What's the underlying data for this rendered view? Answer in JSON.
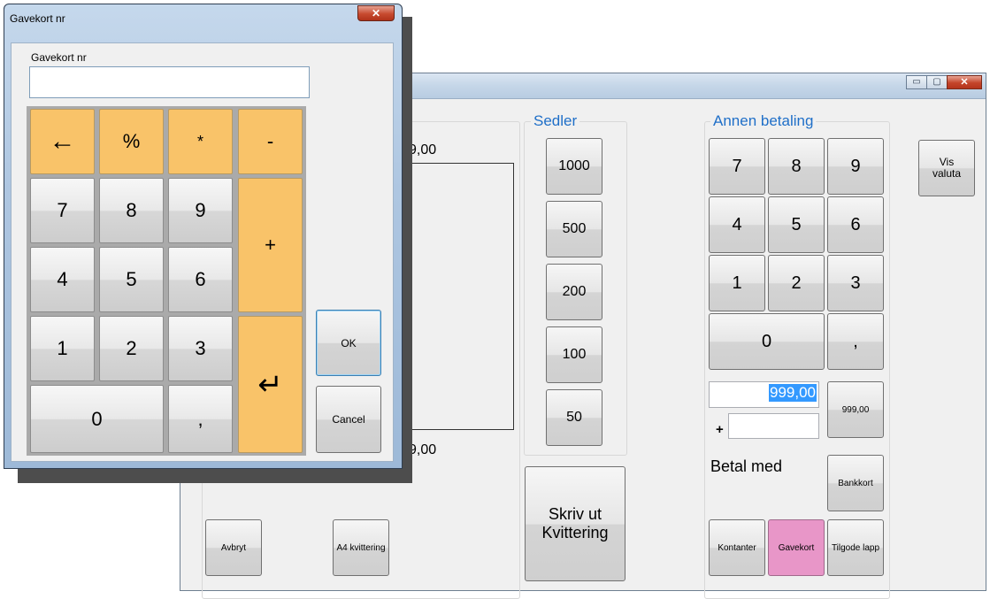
{
  "background_window": {
    "amount_top": "9,00",
    "amount_bottom": "9,00",
    "sedler": {
      "title": "Sedler",
      "notes": [
        "1000",
        "500",
        "200",
        "100",
        "50"
      ]
    },
    "skriv_ut": "Skriv ut Kvittering",
    "annen_betaling": {
      "title": "Annen betaling",
      "keys": [
        "7",
        "8",
        "9",
        "4",
        "5",
        "6",
        "1",
        "2",
        "3",
        "0",
        ","
      ],
      "amount_value": "999,00",
      "amount_button": "999,00",
      "plus_label": "+",
      "plus_value": ""
    },
    "vis_valuta": "Vis valuta",
    "betal_med": "Betal med",
    "bankkort": "Bankkort",
    "kontanter": "Kontanter",
    "gavekort": "Gavekort",
    "tilgode_lapp": "Tilgode lapp",
    "avbryt": "Avbryt",
    "a4_kvittering": "A4 kvittering",
    "window_buttons": {
      "minimize": "▭",
      "maximize": "▢",
      "close": "✕"
    }
  },
  "dialog": {
    "title": "Gavekort nr",
    "close_glyph": "✕",
    "field_label": "Gavekort nr",
    "field_value": "",
    "keys": {
      "backspace": "←",
      "percent": "%",
      "multiply": "*",
      "minus": "-",
      "k7": "7",
      "k8": "8",
      "k9": "9",
      "plus": "+",
      "k4": "4",
      "k5": "5",
      "k6": "6",
      "k1": "1",
      "k2": "2",
      "k3": "3",
      "enter": "↵",
      "k0": "0",
      "comma": ","
    },
    "ok": "OK",
    "cancel": "Cancel"
  },
  "colors": {
    "accent_blue": "#1f6fc8",
    "keypad_orange": "#f9c369",
    "gavekort_pink": "#e896c8",
    "selection_blue": "#3399ff"
  }
}
